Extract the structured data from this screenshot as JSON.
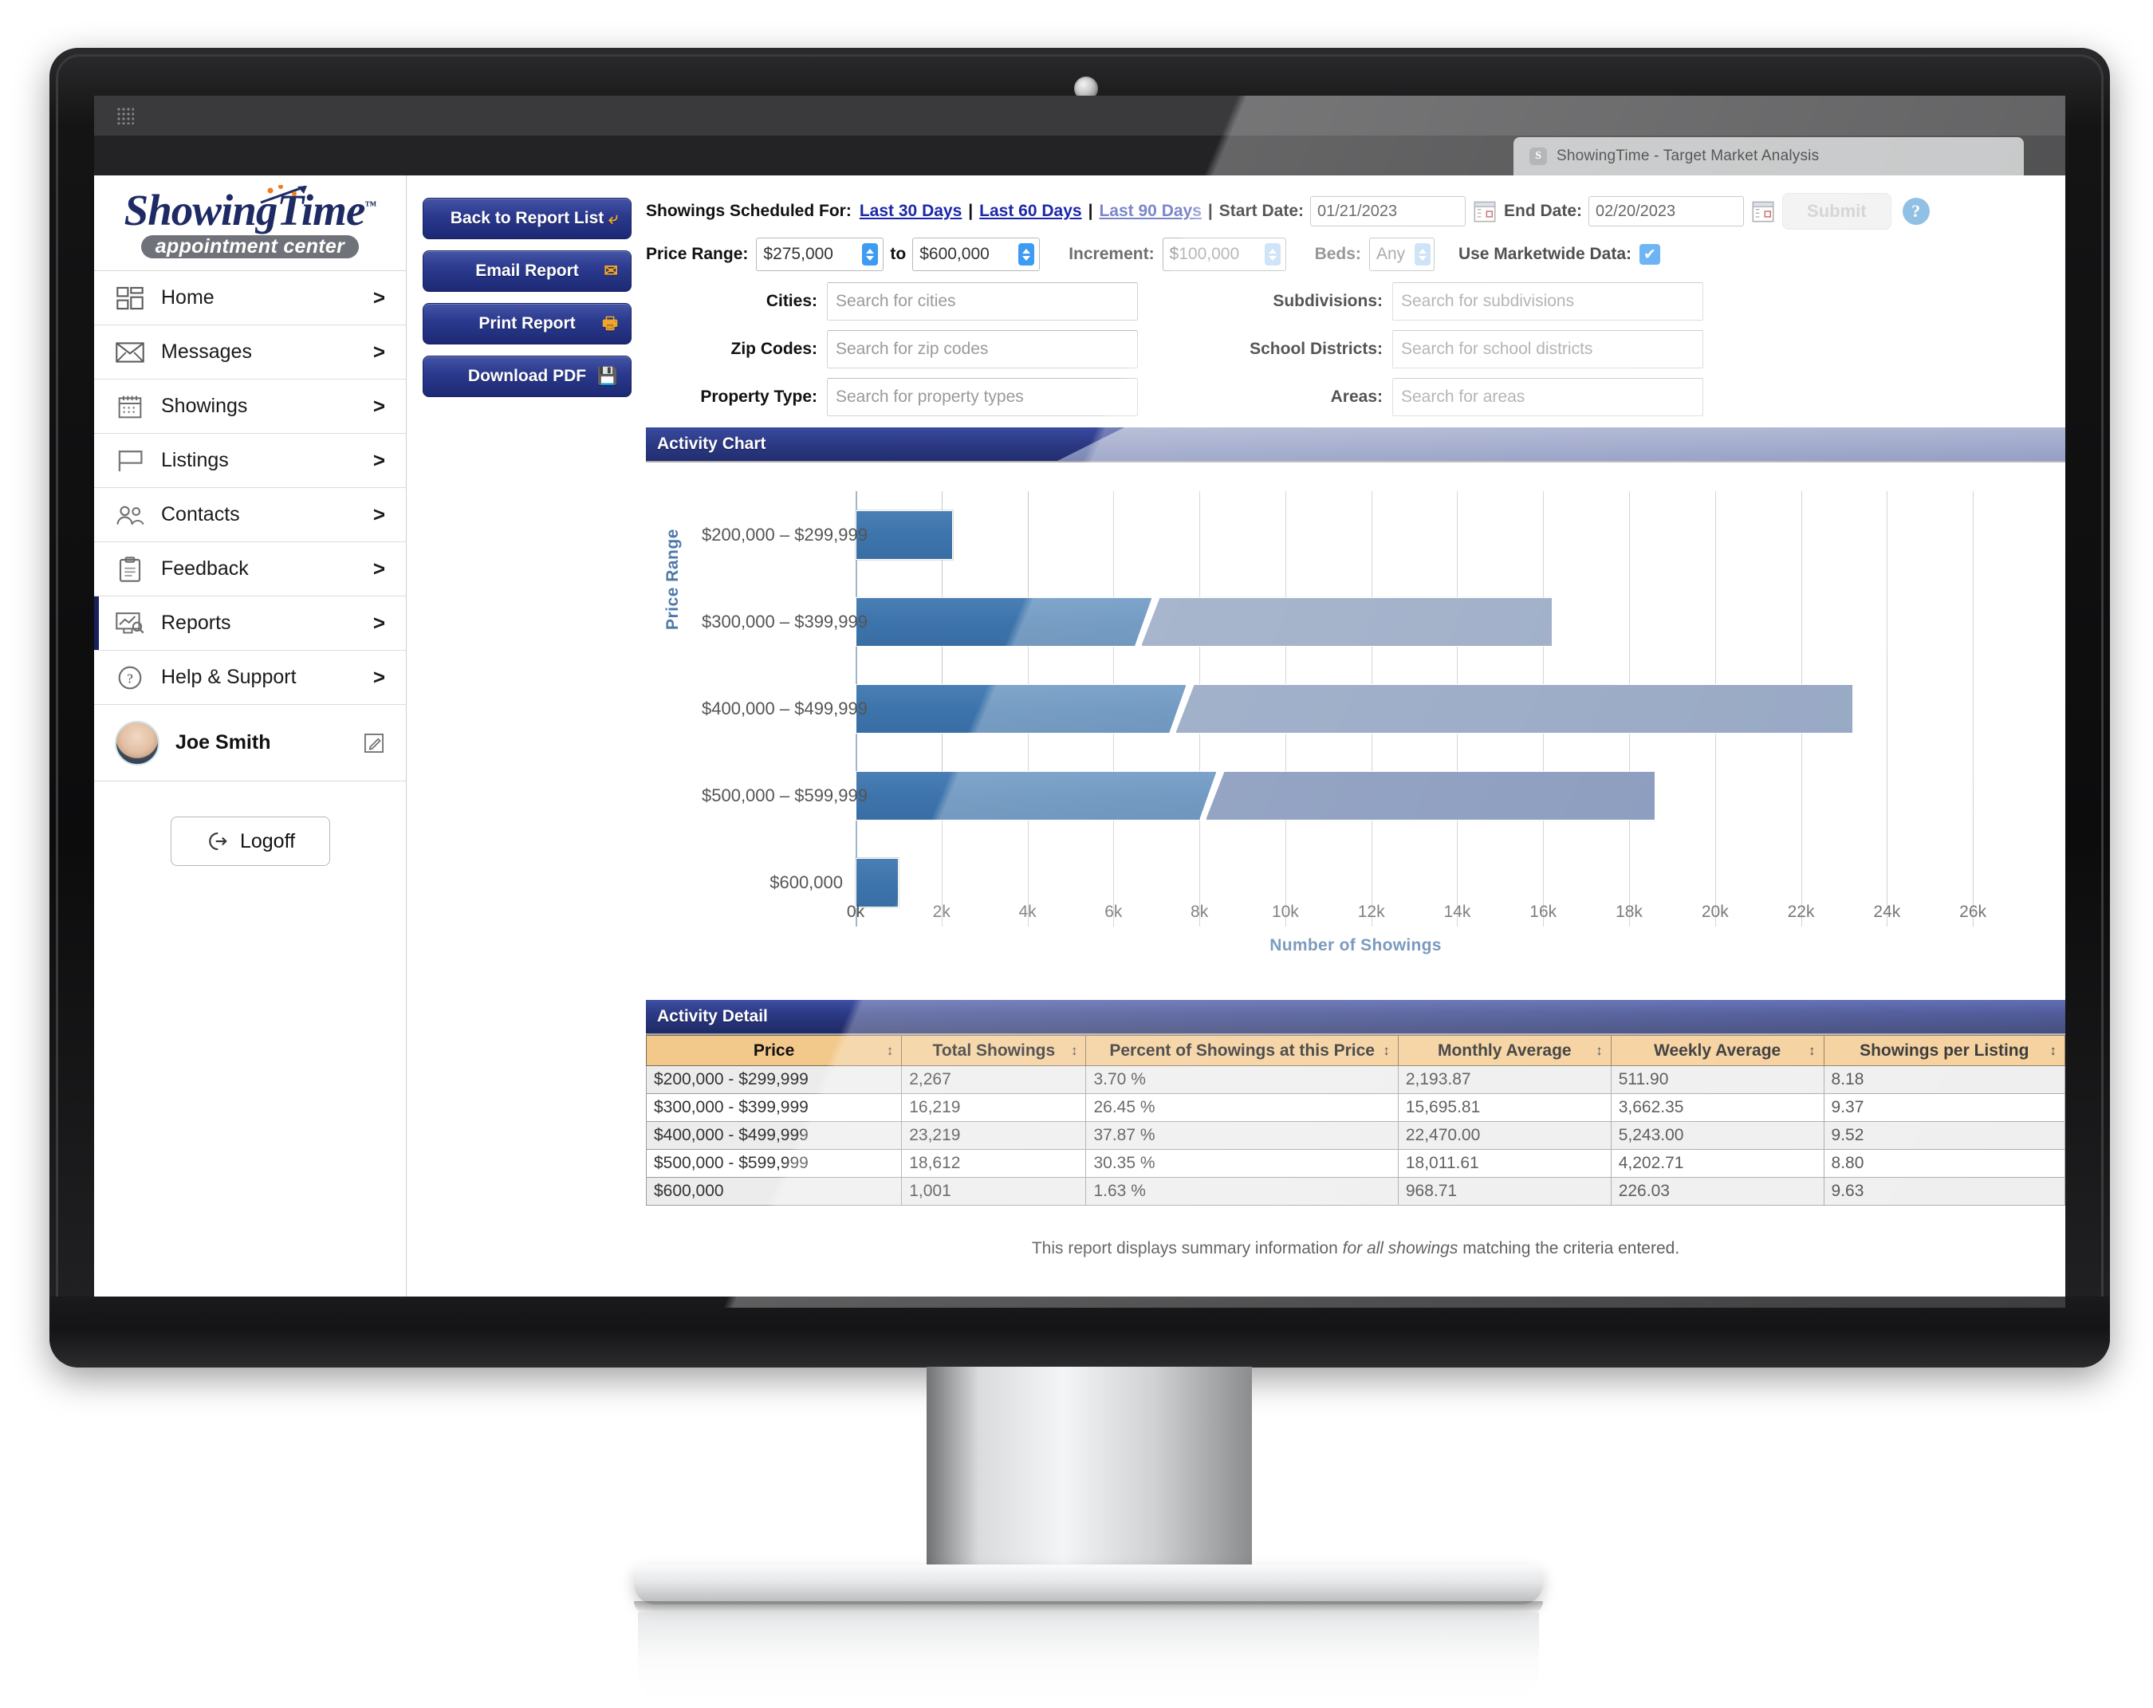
{
  "browser": {
    "tab_title": "ShowingTime - Target Market Analysis",
    "favicon_letter": "S"
  },
  "sidebar": {
    "logo_main": "ShowingTime",
    "logo_tm": "™",
    "logo_sub": "appointment center",
    "items": [
      {
        "label": "Home",
        "icon": "dashboard-icon",
        "chevron": ">"
      },
      {
        "label": "Messages",
        "icon": "envelope-icon",
        "chevron": ">"
      },
      {
        "label": "Showings",
        "icon": "calendar-icon",
        "chevron": ">"
      },
      {
        "label": "Listings",
        "icon": "sign-icon",
        "chevron": ">"
      },
      {
        "label": "Contacts",
        "icon": "people-icon",
        "chevron": ">"
      },
      {
        "label": "Feedback",
        "icon": "clipboard-icon",
        "chevron": ">"
      },
      {
        "label": "Reports",
        "icon": "report-icon",
        "chevron": ">"
      },
      {
        "label": "Help & Support",
        "icon": "question-icon",
        "chevron": ">"
      }
    ],
    "active_item": "Reports",
    "user_name": "Joe Smith",
    "edit_icon": "pencil-square-icon",
    "logoff_label": "Logoff",
    "logoff_icon": "logout-icon"
  },
  "actions": [
    {
      "label": "Back to Report List",
      "icon": "back-arrow-icon"
    },
    {
      "label": "Email Report",
      "icon": "envelope-icon"
    },
    {
      "label": "Print Report",
      "icon": "printer-icon"
    },
    {
      "label": "Download PDF",
      "icon": "floppy-disk-icon"
    }
  ],
  "filters": {
    "scheduled_label": "Showings Scheduled For:",
    "range_links": [
      "Last 30 Days",
      "Last 60 Days",
      "Last 90 Days"
    ],
    "separator": "|",
    "start_date_label": "Start Date:",
    "start_date_value": "01/21/2023",
    "end_date_label": "End Date:",
    "end_date_value": "02/20/2023",
    "submit_label": "Submit",
    "help_icon": "question-mark-icon",
    "calendar_icon": "calendar-picker-icon",
    "price_range_label": "Price Range:",
    "price_min": "$275,000",
    "price_to": "to",
    "price_max": "$600,000",
    "increment_label": "Increment:",
    "increment_value": "$100,000",
    "beds_label": "Beds:",
    "beds_value": "Any",
    "marketwide_label": "Use Marketwide Data:",
    "marketwide_checked": true,
    "check_glyph": "✔",
    "search_fields_left": [
      {
        "label": "Cities:",
        "placeholder": "Search for cities"
      },
      {
        "label": "Zip Codes:",
        "placeholder": "Search for zip codes"
      },
      {
        "label": "Property Type:",
        "placeholder": "Search for property types"
      }
    ],
    "search_fields_right": [
      {
        "label": "Subdivisions:",
        "placeholder": "Search for subdivisions"
      },
      {
        "label": "School Districts:",
        "placeholder": "Search for school districts"
      },
      {
        "label": "Areas:",
        "placeholder": "Search for areas"
      }
    ]
  },
  "panels": {
    "chart_title": "Activity Chart",
    "detail_title": "Activity Detail"
  },
  "chart_data": {
    "type": "bar",
    "orientation": "horizontal",
    "title": "Activity Chart",
    "xlabel": "Number of Showings",
    "ylabel": "Price Range",
    "categories": [
      "$200,000 – $299,999",
      "$300,000 – $399,999",
      "$400,000 – $499,999",
      "$500,000 – $599,999",
      "$600,000"
    ],
    "values": [
      2267,
      16219,
      23219,
      18612,
      1001
    ],
    "segment_split": [
      2267,
      6900,
      7700,
      8400,
      1001
    ],
    "xlim": [
      0,
      27000
    ],
    "xticks": [
      0,
      2000,
      4000,
      6000,
      8000,
      10000,
      12000,
      14000,
      16000,
      18000,
      20000,
      22000,
      24000,
      26000
    ],
    "xtick_labels": [
      "0k",
      "2k",
      "4k",
      "6k",
      "8k",
      "10k",
      "12k",
      "14k",
      "16k",
      "18k",
      "20k",
      "22k",
      "24k",
      "26k"
    ],
    "grid": true,
    "legend": "none",
    "colors": {
      "segment_dark": "#3d74ab",
      "segment_light": "#7f93b5"
    }
  },
  "detail_table": {
    "columns": [
      "Price",
      "Total Showings",
      "Percent of Showings at this Price",
      "Monthly Average",
      "Weekly Average",
      "Showings per Listing"
    ],
    "sort_glyph": "↕",
    "rows": [
      [
        "$200,000 - $299,999",
        "2,267",
        "3.70 %",
        "2,193.87",
        "511.90",
        "8.18"
      ],
      [
        "$300,000 - $399,999",
        "16,219",
        "26.45 %",
        "15,695.81",
        "3,662.35",
        "9.37"
      ],
      [
        "$400,000 - $499,999",
        "23,219",
        "37.87 %",
        "22,470.00",
        "5,243.00",
        "9.52"
      ],
      [
        "$500,000 - $599,999",
        "18,612",
        "30.35 %",
        "18,011.61",
        "4,202.71",
        "8.80"
      ],
      [
        "$600,000",
        "1,001",
        "1.63 %",
        "968.71",
        "226.03",
        "9.63"
      ]
    ]
  },
  "footer_note": {
    "prefix": "This report displays summary information ",
    "emphasis": "for all showings",
    "suffix": " matching the criteria entered."
  }
}
